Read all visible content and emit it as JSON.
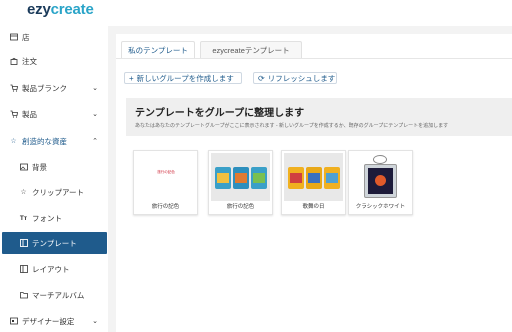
{
  "brand": {
    "part1": "ezy",
    "part2": "create",
    "color_dark": "#1a3a5a",
    "color_accent": "#2aa4c8"
  },
  "sidebar": {
    "accent_color": "#1f5b8c",
    "items": [
      {
        "label": "店",
        "icon": "store-icon"
      },
      {
        "label": "注文",
        "icon": "bag-icon"
      },
      {
        "label": "製品ブランク",
        "icon": "cart-icon"
      },
      {
        "label": "製品",
        "icon": "cart-icon"
      },
      {
        "label": "創造的な資産",
        "icon": "star-icon"
      },
      {
        "label": "背景",
        "icon": "image-icon"
      },
      {
        "label": "クリップアート",
        "icon": "star-icon"
      },
      {
        "label": "フォント",
        "icon": "text-icon"
      },
      {
        "label": "テンプレート",
        "icon": "template-icon"
      },
      {
        "label": "レイアウト",
        "icon": "layout-icon"
      },
      {
        "label": "マーチアルバム",
        "icon": "folder-icon"
      },
      {
        "label": "デザイナー設定",
        "icon": "settings-icon"
      }
    ]
  },
  "tabs": [
    {
      "label": "私のテンプレート"
    },
    {
      "label": "ezycreateテンプレート"
    }
  ],
  "actions": {
    "create_group": "新しいグループを作成します",
    "refresh": "リフレッシュします"
  },
  "banner": {
    "title": "テンプレートをグループに整理します",
    "subtitle": "あなたはあなたのテンプレートグループがここに表示されます - 新しいグループを作成するか、既存のグループにテンプレートを追加します"
  },
  "templates": [
    {
      "label": "旅行の記色",
      "thumb_text": "旅行の記色"
    },
    {
      "label": "旅行の記色"
    },
    {
      "label": "歌舞の日"
    },
    {
      "label": "クラシックホワイト"
    }
  ]
}
